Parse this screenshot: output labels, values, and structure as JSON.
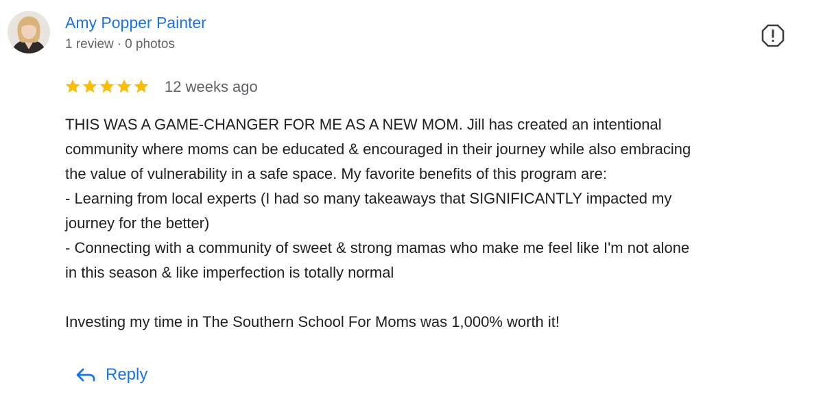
{
  "reviewer": {
    "name": "Amy Popper Painter",
    "reviews": "1 review",
    "separator": "·",
    "photos": "0 photos",
    "avatar_icon": "user-avatar-photo"
  },
  "actions": {
    "report_icon": "report-flag-icon",
    "reply_label": "Reply",
    "reply_icon": "reply-arrow-icon"
  },
  "review": {
    "rating": 5,
    "rating_max": 5,
    "star_color": "#fbbc04",
    "date": "12 weeks ago",
    "lines": [
      "THIS WAS A GAME-CHANGER FOR ME AS A NEW MOM. Jill has created an intentional",
      "community where moms can be educated & encouraged in their journey while also embracing",
      "the value of vulnerability in a safe space. My favorite benefits of this program are:",
      "- Learning from local experts (I had so many takeaways that SIGNIFICANTLY impacted my",
      "journey for the better)",
      "- Connecting with a community of sweet & strong mamas who make me feel like I'm not alone",
      "in this season & like imperfection is totally normal",
      "",
      "Investing my time in The Southern School For Moms was 1,000% worth it!"
    ]
  },
  "colors": {
    "link_blue": "#1a73e8",
    "secondary_text": "#5f6368",
    "primary_text": "#202124"
  }
}
